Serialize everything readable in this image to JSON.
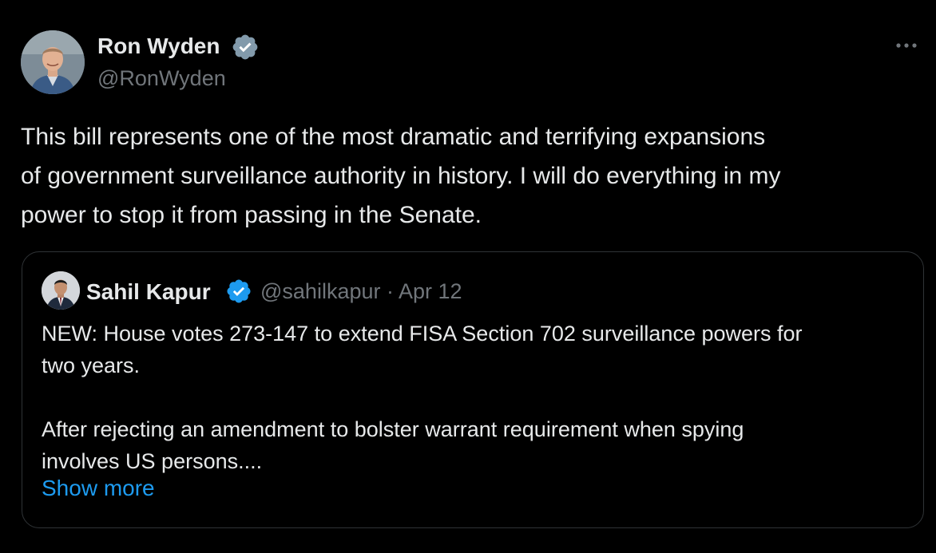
{
  "author": {
    "name": "Ron Wyden",
    "handle": "@RonWyden",
    "verified": true,
    "verified_color": "#829aab"
  },
  "tweet": {
    "lines": [
      "This bill represents one of the most dramatic and terrifying expansions",
      "of government surveillance authority in history. I will do everything in my",
      "power to stop it from passing in the Senate."
    ]
  },
  "quoted": {
    "name": "Sahil Kapur",
    "handle": "@sahilkapur",
    "separator": "·",
    "date": "Apr 12",
    "verified": true,
    "verified_color": "#1d9bf0",
    "lines": [
      "NEW: House votes 273-147 to extend FISA Section 702 surveillance powers for",
      "two years.",
      "",
      "After rejecting an amendment to bolster warrant requirement when spying",
      "involves US persons...."
    ],
    "show_more": "Show more"
  },
  "icons": {
    "more": "more-horizontal-icon",
    "verified": "verified-badge-icon"
  },
  "colors": {
    "background": "#000000",
    "text": "#e7e9ea",
    "secondary_text": "#71767b",
    "link": "#1d9bf0",
    "border": "#2f3336"
  }
}
